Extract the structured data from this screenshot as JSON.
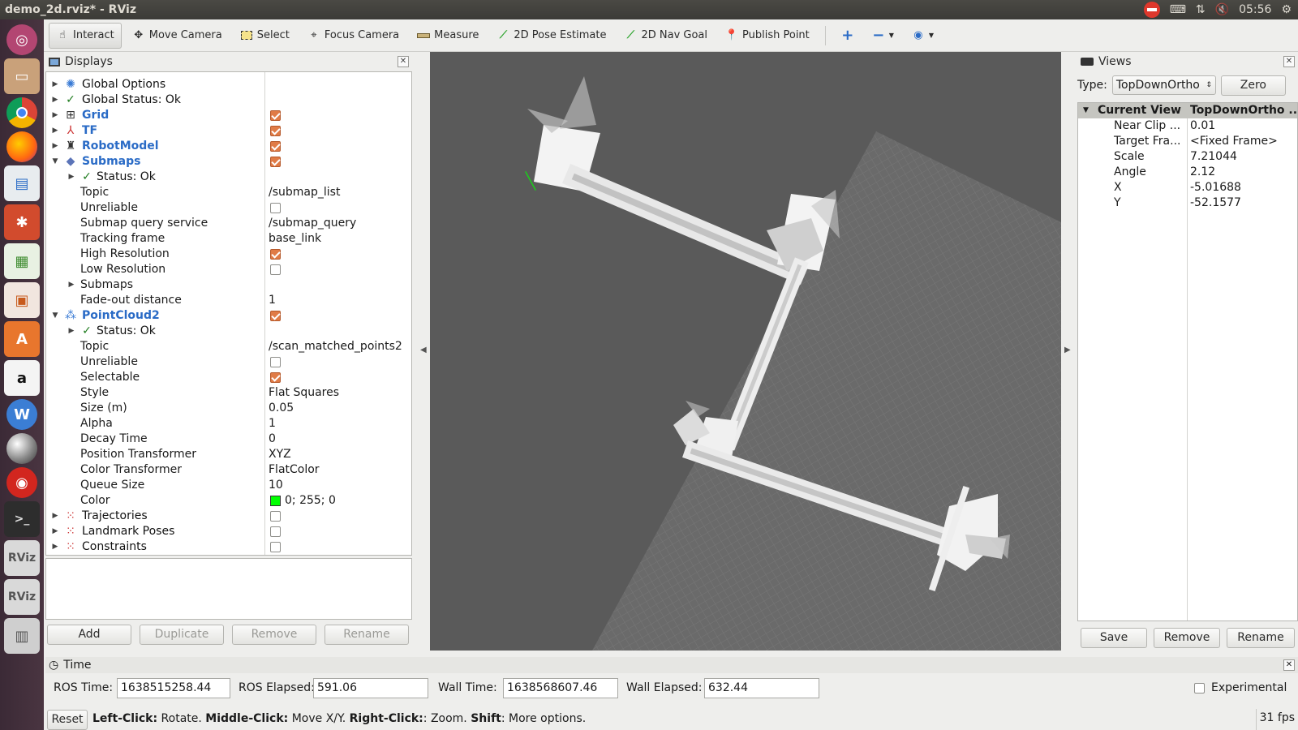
{
  "window": {
    "title": "demo_2d.rviz* - RViz",
    "clock": "05:56"
  },
  "toolbar": {
    "tools": [
      {
        "label": "Interact",
        "icon": "hand-pointer-icon",
        "active": true
      },
      {
        "label": "Move Camera",
        "icon": "move-camera-icon",
        "active": false
      },
      {
        "label": "Select",
        "icon": "select-rectangle-icon",
        "active": false
      },
      {
        "label": "Focus Camera",
        "icon": "focus-camera-icon",
        "active": false
      },
      {
        "label": "Measure",
        "icon": "ruler-icon",
        "active": false
      },
      {
        "label": "2D Pose Estimate",
        "icon": "green-arrow-icon",
        "active": false
      },
      {
        "label": "2D Nav Goal",
        "icon": "green-arrow-icon",
        "active": false
      },
      {
        "label": "Publish Point",
        "icon": "red-pin-icon",
        "active": false
      }
    ]
  },
  "displays": {
    "title": "Displays",
    "rows": [
      {
        "name": "Global Options"
      },
      {
        "name": "Global Status: Ok"
      },
      {
        "name": "Grid"
      },
      {
        "name": "TF"
      },
      {
        "name": "RobotModel"
      },
      {
        "name": "Submaps"
      },
      {
        "name": "Status: Ok"
      },
      {
        "name": "Topic",
        "value": "/submap_list"
      },
      {
        "name": "Unreliable"
      },
      {
        "name": "Submap query service",
        "value": "/submap_query"
      },
      {
        "name": "Tracking frame",
        "value": "base_link"
      },
      {
        "name": "High Resolution"
      },
      {
        "name": "Low Resolution"
      },
      {
        "name": "Submaps"
      },
      {
        "name": "Fade-out distance",
        "value": "1"
      },
      {
        "name": "PointCloud2"
      },
      {
        "name": "Status: Ok"
      },
      {
        "name": "Topic",
        "value": "/scan_matched_points2"
      },
      {
        "name": "Unreliable"
      },
      {
        "name": "Selectable"
      },
      {
        "name": "Style",
        "value": "Flat Squares"
      },
      {
        "name": "Size (m)",
        "value": "0.05"
      },
      {
        "name": "Alpha",
        "value": "1"
      },
      {
        "name": "Decay Time",
        "value": "0"
      },
      {
        "name": "Position Transformer",
        "value": "XYZ"
      },
      {
        "name": "Color Transformer",
        "value": "FlatColor"
      },
      {
        "name": "Queue Size",
        "value": "10"
      },
      {
        "name": "Color",
        "value": "0; 255; 0"
      },
      {
        "name": "Trajectories"
      },
      {
        "name": "Landmark Poses"
      },
      {
        "name": "Constraints"
      }
    ],
    "buttons": {
      "add": "Add",
      "duplicate": "Duplicate",
      "remove": "Remove",
      "rename": "Rename"
    }
  },
  "views": {
    "title": "Views",
    "type_label": "Type:",
    "type_value": "TopDownOrtho",
    "zero": "Zero",
    "header": {
      "key": "Current View",
      "value": "TopDownOrtho ..."
    },
    "props": [
      {
        "key": "Near Clip ...",
        "value": "0.01"
      },
      {
        "key": "Target Fra...",
        "value": "<Fixed Frame>"
      },
      {
        "key": "Scale",
        "value": "7.21044"
      },
      {
        "key": "Angle",
        "value": "2.12"
      },
      {
        "key": "X",
        "value": "-5.01688"
      },
      {
        "key": "Y",
        "value": "-52.1577"
      }
    ],
    "buttons": {
      "save": "Save",
      "remove": "Remove",
      "rename": "Rename"
    }
  },
  "time": {
    "title": "Time",
    "ros_time_label": "ROS Time:",
    "ros_time": "1638515258.44",
    "ros_elapsed_label": "ROS Elapsed:",
    "ros_elapsed": "591.06",
    "wall_time_label": "Wall Time:",
    "wall_time": "1638568607.46",
    "wall_elapsed_label": "Wall Elapsed:",
    "wall_elapsed": "632.44",
    "experimental": "Experimental"
  },
  "status": {
    "reset": "Reset",
    "lc": "Left-Click:",
    "lc_text": " Rotate. ",
    "mc": "Middle-Click:",
    "mc_text": " Move X/Y. ",
    "rc": "Right-Click:",
    "rc_text": ": Zoom. ",
    "sh": "Shift",
    "sh_text": ": More options.",
    "fps": "31 fps"
  },
  "colors": {
    "accent_blue": "#2a6bc6",
    "check_orange": "#e07b46",
    "point_color": "#00ff00",
    "render_bg": "#5a5a5a"
  }
}
